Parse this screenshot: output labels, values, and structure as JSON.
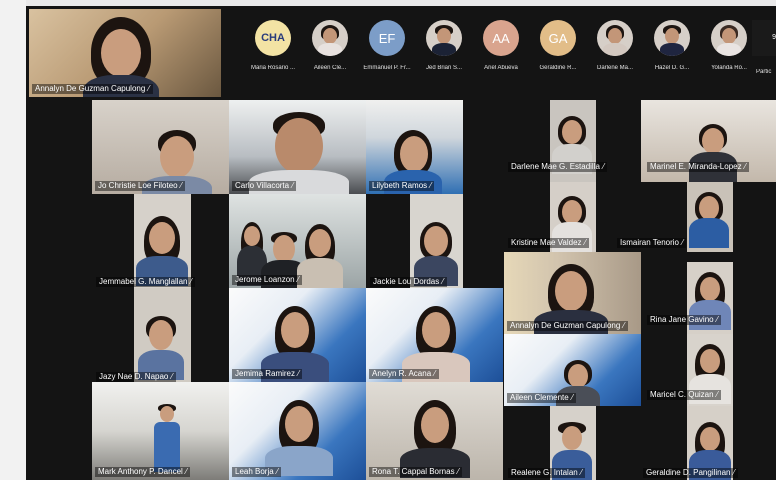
{
  "self_view": {
    "name": "Annalyn De Guzman Capulong"
  },
  "avatar_bar": [
    {
      "initials": "CHA",
      "name": "Maria Rosario ...",
      "color": "#f0e2a9",
      "type": "logo"
    },
    {
      "initials": "",
      "name": "Aileen Cle...",
      "color": "#e4d9d2",
      "type": "photo"
    },
    {
      "initials": "EF",
      "name": "Emmanuel P. Fr...",
      "color": "#7b9ec9",
      "type": "initials"
    },
    {
      "initials": "",
      "name": "Jed Brian S...",
      "color": "#d8d2cd",
      "type": "photo"
    },
    {
      "initials": "AA",
      "name": "Ariel Abueva",
      "color": "#d9a58f",
      "type": "initials"
    },
    {
      "initials": "GA",
      "name": "Geraldine R...",
      "color": "#e1be8a",
      "type": "initials"
    },
    {
      "initials": "",
      "name": "Darlene Ma...",
      "color": "#ddd6d0",
      "type": "photo"
    },
    {
      "initials": "",
      "name": "Hazel D. G...",
      "color": "#d7d2cd",
      "type": "photo"
    },
    {
      "initials": "",
      "name": "Yolanda Ro...",
      "color": "#dcd3cb",
      "type": "photo"
    }
  ],
  "participants_label": "Partic",
  "participants_count": "9",
  "tiles": [
    {
      "name": "Jo Christie Loe Filoteo"
    },
    {
      "name": "Carlo Villacorta"
    },
    {
      "name": "Lilybeth Ramos"
    },
    {
      "name": "Darlene Mae G. Estadilla"
    },
    {
      "name": "Marinel E. Miranda-Lopez"
    },
    {
      "name": "Jemmabel G. Manglallan"
    },
    {
      "name": "Jerome Loanzon"
    },
    {
      "name": "Jackie Lou Dordas"
    },
    {
      "name": "Kristine Mae Valdez"
    },
    {
      "name": "Ismairan Tenorio"
    },
    {
      "name": "Annalyn De Guzman Capulong"
    },
    {
      "name": "Rina Jane Gavino"
    },
    {
      "name": "Jazy Nae D. Napao"
    },
    {
      "name": "Jemima Ramirez"
    },
    {
      "name": "Anelyn R. Acana"
    },
    {
      "name": "Aileen Clemente"
    },
    {
      "name": "Maricel C. Quizan"
    },
    {
      "name": "Mark Anthony P. Dancel"
    },
    {
      "name": "Leah Borja"
    },
    {
      "name": "Rona T. Cappal Bornas"
    },
    {
      "name": "Realene G. Intalan"
    },
    {
      "name": "Geraldine D. Pangilinan"
    }
  ]
}
